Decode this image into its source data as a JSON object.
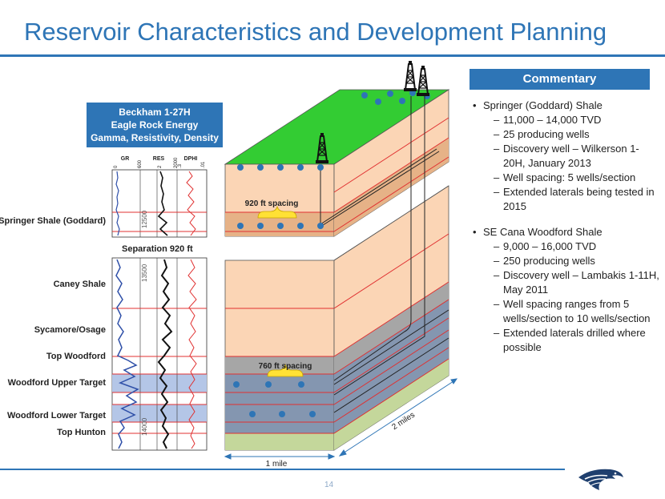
{
  "title": "Reservoir Characteristics and Development Planning",
  "page_number": "14",
  "commentary": {
    "header": "Commentary",
    "sections": [
      {
        "bullet": "Springer (Goddard) Shale",
        "subs": [
          "11,000 – 14,000 TVD",
          "25 producing wells",
          "Discovery well – Wilkerson 1-20H, January 2013",
          "Well spacing: 5 wells/section",
          "Extended laterals being tested in 2015"
        ]
      },
      {
        "bullet": "SE Cana Woodford Shale",
        "subs": [
          "9,000 – 16,000 TVD",
          "250 producing wells",
          "Discovery well – Lambakis 1-11H, May 2011",
          "Well spacing ranges from 5 wells/section to 10 wells/section",
          "Extended laterals drilled where possible"
        ]
      }
    ]
  },
  "log": {
    "header": [
      "Beckham 1-27H",
      "Eagle Rock Energy",
      "Gamma, Resistivity, Density"
    ],
    "tracks": [
      "GR",
      "RES",
      "DPHI"
    ],
    "scales": [
      "0",
      "600",
      "2",
      "2000",
      ".3",
      ".01"
    ],
    "depths": [
      "12500",
      "13500",
      "14000"
    ],
    "separation": "Separation 920 ft",
    "formations": [
      "Springer Shale (Goddard)",
      "Caney Shale",
      "Sycamore/Osage",
      "Top Woodford",
      "Woodford Upper Target",
      "Woodford Lower Target",
      "Top Hunton"
    ]
  },
  "block": {
    "spacing_upper": "920 ft spacing",
    "spacing_lower": "760 ft spacing",
    "width_label": "1 mile",
    "depth_label": "2 miles"
  },
  "colors": {
    "accent": "#2e75b6",
    "shale": "#fbd5b5",
    "springer": "#e6b287",
    "woodford": "#8496b0",
    "grey_zone": "#a6a6a6",
    "hunton": "#c4d79b",
    "surface": "#33cc33",
    "well_dot": "#2e75b6",
    "spacing_brace": "#ffe135"
  }
}
